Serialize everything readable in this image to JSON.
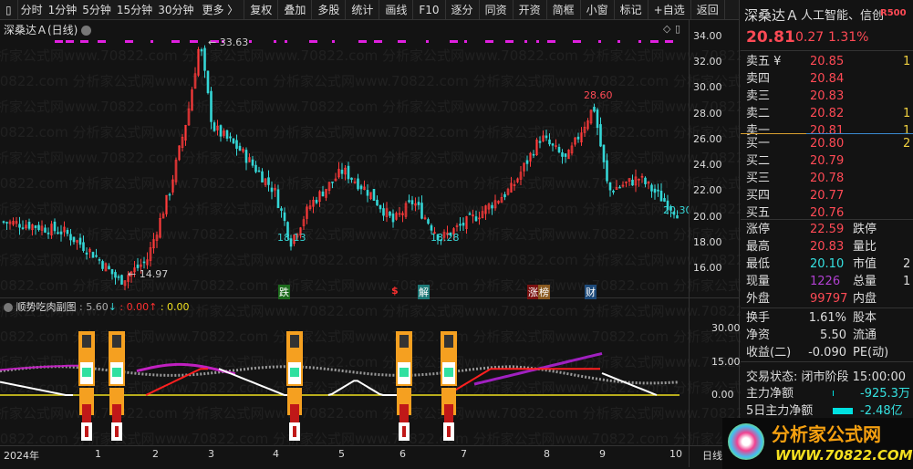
{
  "toolbar": {
    "items": [
      "分时",
      "1分钟",
      "5分钟",
      "15分钟",
      "30分钟",
      "更多 〉",
      "复权",
      "叠加",
      "多股",
      "统计",
      "画线",
      "F10",
      "逐分",
      "同资",
      "开资",
      "简框",
      "小窗",
      "标记",
      "+自选",
      "返回"
    ]
  },
  "chart": {
    "title": "深桑达Ａ(日线)",
    "price_axis": [
      "34.00",
      "32.00",
      "30.00",
      "28.00",
      "26.00",
      "24.00",
      "22.00",
      "20.00",
      "18.00",
      "16.00"
    ],
    "annotations": {
      "high": "33.63",
      "low": "14.97",
      "peak2": "28.60",
      "low2": "18.13",
      "low3": "18.28",
      "last": "20.30"
    },
    "event_tags": [
      {
        "label": "跌",
        "color": "#1d6b1d"
      },
      {
        "label": "$",
        "color": "#131313"
      },
      {
        "label": "解",
        "color": "#1e7a78"
      },
      {
        "label": "涨",
        "color": "#7a1010"
      },
      {
        "label": "榜",
        "color": "#8a5a20"
      },
      {
        "label": "财",
        "color": "#1d4a7a"
      }
    ],
    "kline": {
      "type": "candlestick",
      "up_color": "#ff3b3b",
      "down_color": "#35d6d6",
      "keypoints": [
        [
          0,
          19.6
        ],
        [
          30,
          19.4
        ],
        [
          70,
          18.8
        ],
        [
          100,
          17.2
        ],
        [
          130,
          15.0
        ],
        [
          160,
          16.6
        ],
        [
          185,
          22.0
        ],
        [
          205,
          28.0
        ],
        [
          218,
          33.6
        ],
        [
          232,
          27.0
        ],
        [
          262,
          25.2
        ],
        [
          300,
          22.0
        ],
        [
          318,
          18.1
        ],
        [
          340,
          21.0
        ],
        [
          375,
          23.6
        ],
        [
          405,
          21.8
        ],
        [
          430,
          19.6
        ],
        [
          452,
          21.2
        ],
        [
          482,
          18.3
        ],
        [
          520,
          20.0
        ],
        [
          560,
          22.2
        ],
        [
          592,
          26.2
        ],
        [
          620,
          24.4
        ],
        [
          650,
          28.6
        ],
        [
          666,
          22.0
        ],
        [
          700,
          23.0
        ],
        [
          742,
          20.3
        ]
      ]
    }
  },
  "sub": {
    "name": "顺势吃肉副图",
    "v1": ": 5.60",
    "v2": ": 0.00",
    "v3": ": 0.00",
    "axis": [
      "30.00",
      "15.00",
      "0.00"
    ]
  },
  "dates": {
    "year": "2024年",
    "months": [
      "1",
      "2",
      "3",
      "4",
      "5",
      "6",
      "7",
      "8",
      "9",
      "10"
    ],
    "period": "日线"
  },
  "quote": {
    "name": "深桑达Ａ",
    "concept": "人工智能、信创",
    "badge": "R500",
    "price": "20.81",
    "change": "0.27",
    "pct": "1.31%",
    "sell": [
      {
        "l": "卖五 ¥",
        "p": "20.85",
        "v": "1"
      },
      {
        "l": "卖四",
        "p": "20.84",
        "v": ""
      },
      {
        "l": "卖三",
        "p": "20.83",
        "v": ""
      },
      {
        "l": "卖二",
        "p": "20.82",
        "v": "1"
      },
      {
        "l": "卖一",
        "p": "20.81",
        "v": "1"
      }
    ],
    "buy": [
      {
        "l": "买一",
        "p": "20.80",
        "v": "2"
      },
      {
        "l": "买二",
        "p": "20.79",
        "v": ""
      },
      {
        "l": "买三",
        "p": "20.78",
        "v": ""
      },
      {
        "l": "买四",
        "p": "20.77",
        "v": ""
      },
      {
        "l": "买五",
        "p": "20.76",
        "v": ""
      }
    ],
    "stats": [
      {
        "l": "涨停",
        "v": "22.59",
        "c": "#ff4a55",
        "l2": "跌停",
        "v2": ""
      },
      {
        "l": "最高",
        "v": "20.83",
        "c": "#ff4a55",
        "l2": "量比",
        "v2": ""
      },
      {
        "l": "最低",
        "v": "20.10",
        "c": "#35e0e0",
        "l2": "市值",
        "v2": "2"
      },
      {
        "l": "现量",
        "v": "1226",
        "c": "#b040d0",
        "l2": "总量",
        "v2": "1"
      },
      {
        "l": "外盘",
        "v": "99797",
        "c": "#ff4a55",
        "l2": "内盘",
        "v2": ""
      }
    ],
    "stats2": [
      {
        "l": "换手",
        "v": "1.61%",
        "l2": "股本"
      },
      {
        "l": "净资",
        "v": "5.50",
        "l2": "流通"
      },
      {
        "l": "收益(二)",
        "v": "-0.090",
        "l2": "PE(动)"
      }
    ],
    "status_label": "交易状态:",
    "status": "闭市阶段 15:00:00",
    "flow": [
      {
        "l": "主力净额",
        "v": "-925.3万"
      },
      {
        "l": "5日主力净额",
        "v": "-2.48亿"
      }
    ],
    "logo": {
      "text": "分析家公式网",
      "url": "WWW.70822.COM"
    }
  },
  "watermark": "分析家公式网www.70822.com"
}
